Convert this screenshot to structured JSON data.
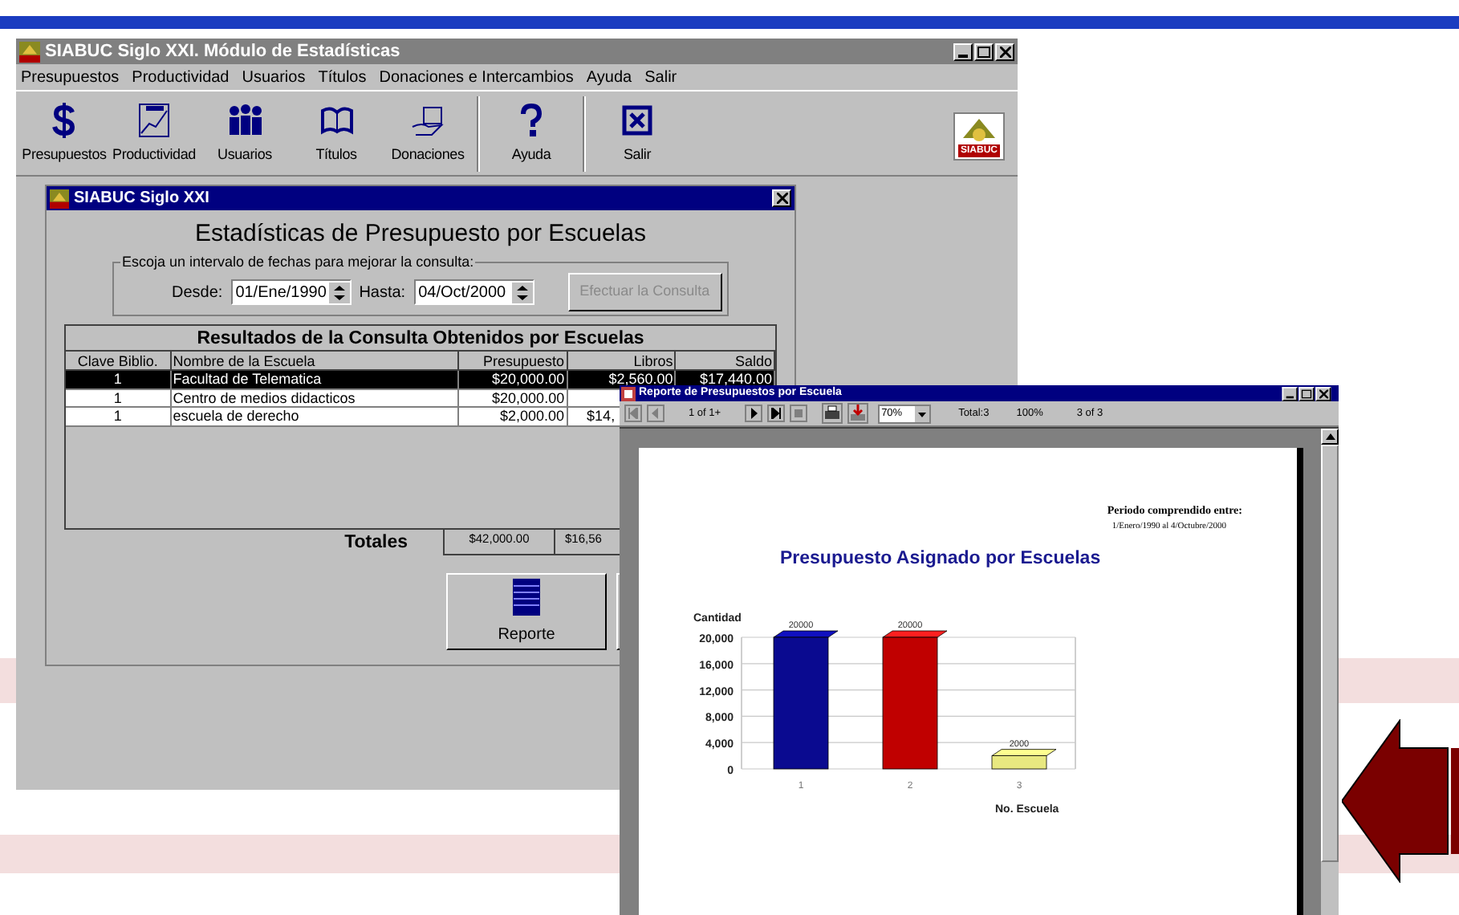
{
  "main_window": {
    "title": "SIABUC Siglo XXI. Módulo de Estadísticas",
    "menu": [
      "Presupuestos",
      "Productividad",
      "Usuarios",
      "Títulos",
      "Donaciones e Intercambios",
      "Ayuda",
      "Salir"
    ],
    "toolbar": [
      {
        "kind": "dollar",
        "label": "Presupuestos"
      },
      {
        "kind": "chart",
        "label": "Productividad"
      },
      {
        "kind": "people",
        "label": "Usuarios"
      },
      {
        "kind": "book",
        "label": "Títulos"
      },
      {
        "kind": "gift",
        "label": "Donaciones"
      },
      {
        "kind": "help",
        "label": "Ayuda"
      },
      {
        "kind": "exit",
        "label": "Salir"
      }
    ],
    "logo": "SIABUC"
  },
  "dialog": {
    "title": "SIABUC Siglo XXI",
    "heading": "Estadísticas de Presupuesto por Escuelas",
    "group_label": "Escoja un intervalo de fechas para mejorar la consulta:",
    "desde_label": "Desde:",
    "desde_value": "01/Ene/1990",
    "hasta_label": "Hasta:",
    "hasta_value": "04/Oct/2000",
    "query_button": {
      "label": "Efectuar la Consulta",
      "disabled": true
    },
    "table": {
      "title": "Resultados de la Consulta Obtenidos por Escuelas",
      "columns": [
        "Clave Biblio.",
        "Nombre de la Escuela",
        "Presupuesto",
        "Libros",
        "Saldo"
      ],
      "rows": [
        {
          "selected": true,
          "cells": [
            "1",
            "Facultad de Telematica",
            "$20,000.00",
            "$2,560.00",
            "$17,440.00"
          ]
        },
        {
          "selected": false,
          "cells": [
            "1",
            "Centro de medios didacticos",
            "$20,000.00"
          ]
        },
        {
          "selected": false,
          "cells": [
            "1",
            "escuela de derecho",
            "$2,000.00",
            "$14,"
          ]
        }
      ]
    },
    "totals_label": "Totales",
    "totals": [
      "$42,000.00",
      "$16,56"
    ],
    "report_button": "Reporte"
  },
  "report_window": {
    "title": "Reporte de Presupuestos por Escuela",
    "page_of": "1 of 1+",
    "zoom": "70%",
    "total": "Total:3",
    "percent": "100%",
    "records": "3 of 3",
    "period_label": "Periodo comprendido entre:",
    "period": "1/Enero/1990 al 4/Octubre/2000",
    "chart_data": {
      "type": "bar",
      "title": "Presupuesto Asignado por Escuelas",
      "ylabel": "Cantidad",
      "xlabel": "No. Escuela",
      "categories": [
        "1",
        "2",
        "3"
      ],
      "values": [
        20000,
        20000,
        2000
      ],
      "yticks": [
        {
          "value": 0,
          "label": "0"
        },
        {
          "value": 4000,
          "label": "4,000"
        },
        {
          "value": 8000,
          "label": "8,000"
        },
        {
          "value": 12000,
          "label": "12,000"
        },
        {
          "value": 16000,
          "label": "16,000"
        },
        {
          "value": 20000,
          "label": "20,000"
        }
      ],
      "ylim": [
        0,
        20000
      ],
      "data_labels": true,
      "grid": true
    }
  }
}
